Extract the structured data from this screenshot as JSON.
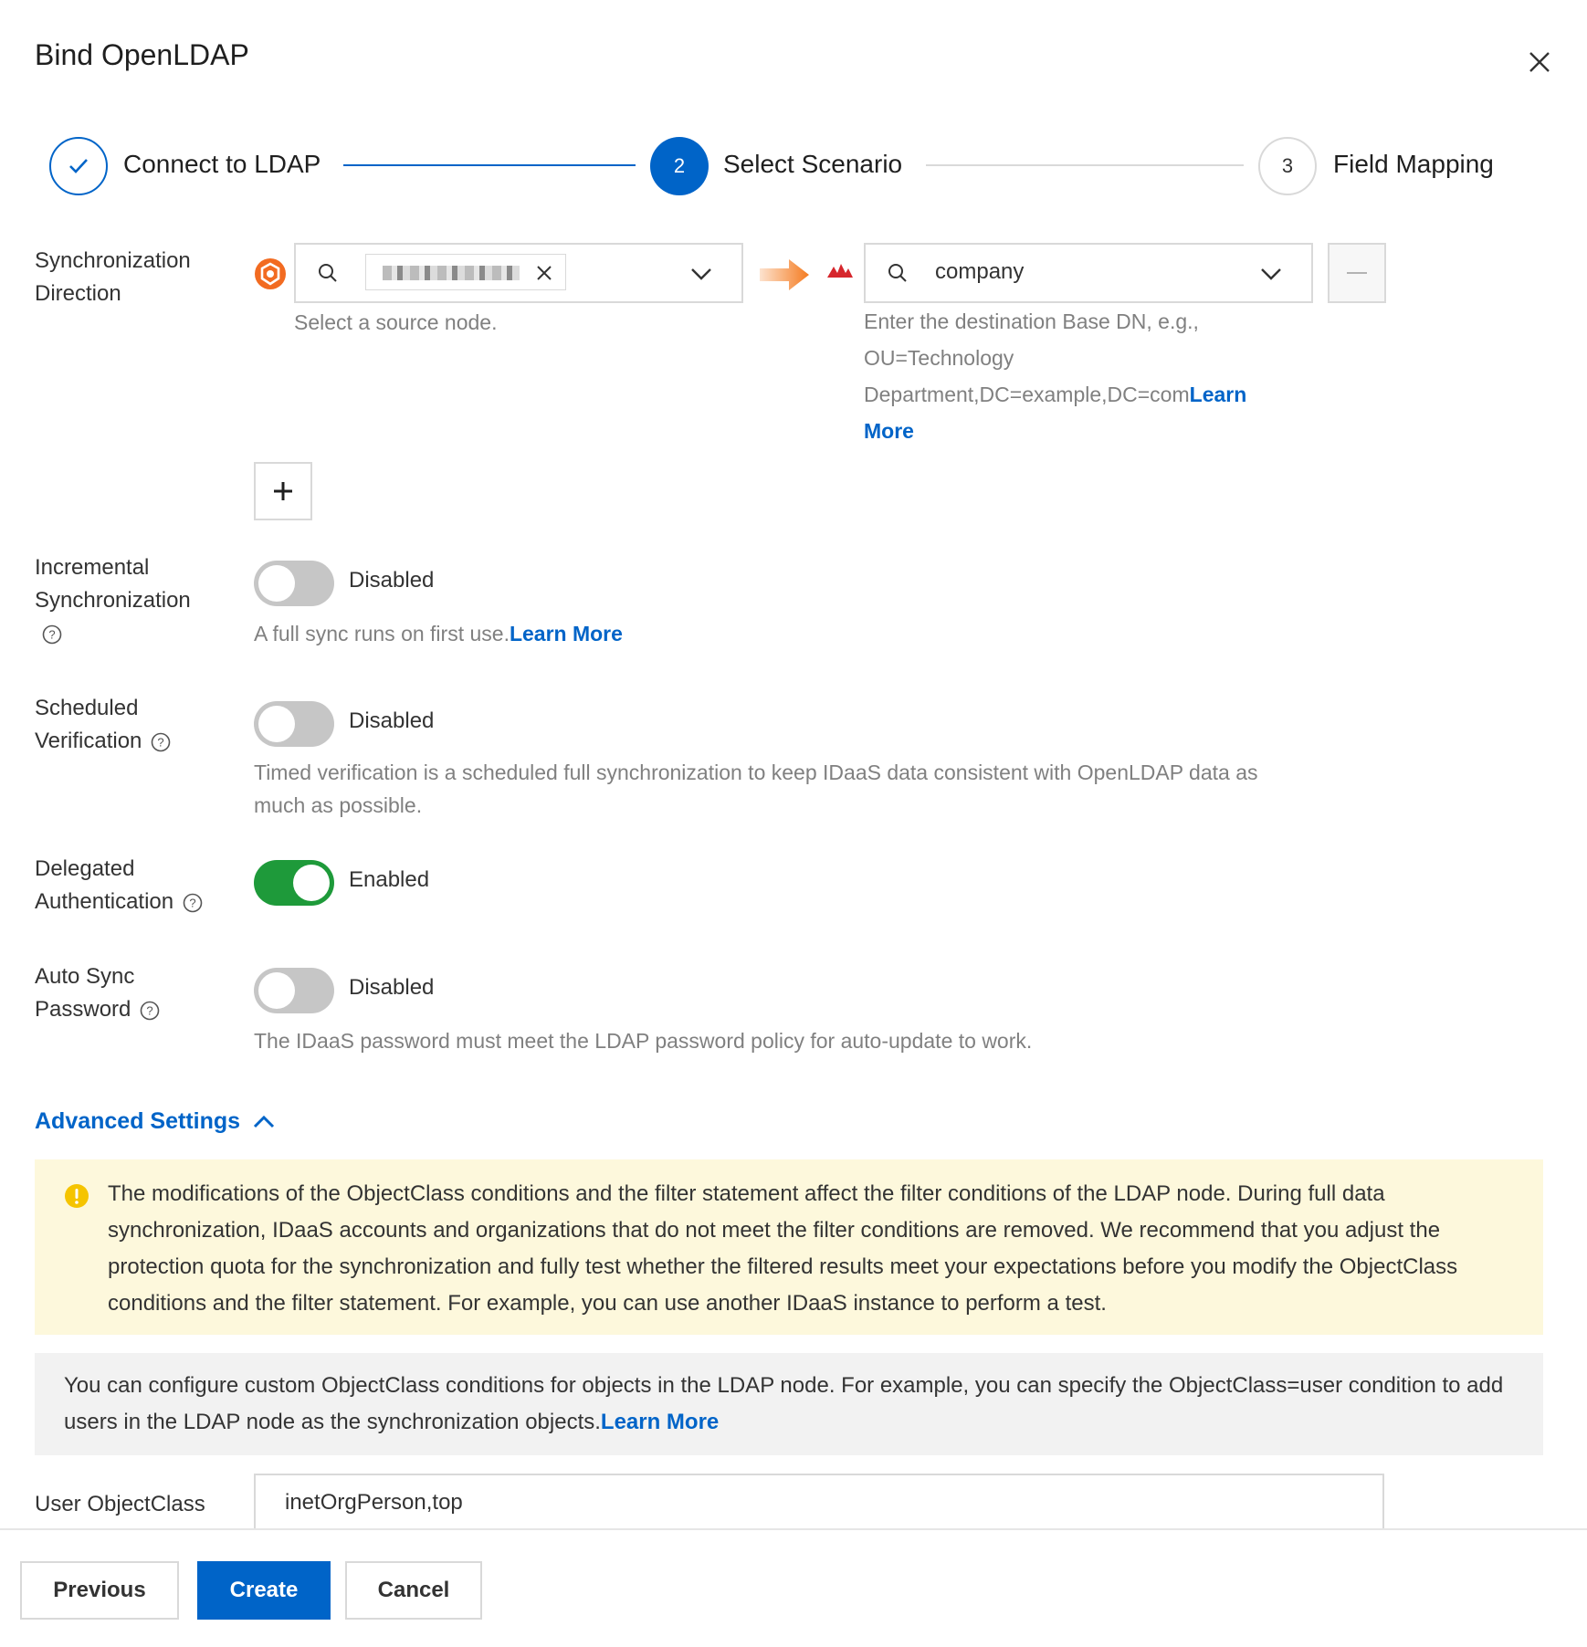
{
  "dialog": {
    "title": "Bind OpenLDAP"
  },
  "steps": [
    {
      "label": "Connect to LDAP",
      "status": "done"
    },
    {
      "number": "2",
      "label": "Select Scenario",
      "status": "active"
    },
    {
      "number": "3",
      "label": "Field Mapping",
      "status": "pending"
    }
  ],
  "sync_direction": {
    "label_line1": "Synchronization",
    "label_line2": "Direction",
    "source": {
      "icon": "idaas-logo-icon",
      "selected_tag": "redacted",
      "hint": "Select a source node."
    },
    "destination": {
      "icon": "openldap-logo-icon",
      "value": "company",
      "hint_line1": "Enter the destination Base DN, e.g.,",
      "hint_line2": "OU=Technology",
      "hint_line3": "Department,DC=example,DC=com",
      "link_part1": "Learn",
      "link_part2": "More"
    },
    "add_label": "+"
  },
  "incremental_sync": {
    "label_line1": "Incremental",
    "label_line2": "Synchronization",
    "state": "Disabled",
    "hint": "A full sync runs on first use.",
    "link": "Learn More"
  },
  "scheduled_verification": {
    "label_line1": "Scheduled",
    "label_line2": "Verification",
    "state": "Disabled",
    "hint_line1": "Timed verification is a scheduled full synchronization to keep IDaaS data consistent with OpenLDAP data as",
    "hint_line2": "much as possible."
  },
  "delegated_auth": {
    "label_line1": "Delegated",
    "label_line2": "Authentication",
    "state": "Enabled"
  },
  "auto_sync_password": {
    "label_line1": "Auto Sync",
    "label_line2": "Password",
    "state": "Disabled",
    "hint": "The IDaaS password must meet the LDAP password policy for auto-update to work."
  },
  "advanced": {
    "label": "Advanced Settings",
    "warning": "The modifications of the ObjectClass conditions and the filter statement affect the filter conditions of the LDAP node. During full data synchronization, IDaaS accounts and organizations that do not meet the filter conditions are removed. We recommend that you adjust the protection quota for the synchronization and fully test whether the filtered results meet your expectations before you modify the ObjectClass conditions and the filter statement. For example, you can use another IDaaS instance to perform a test.",
    "info": "You can configure custom ObjectClass conditions for objects in the LDAP node. For example, you can specify the ObjectClass=user condition to add users in the LDAP node as the synchronization objects.",
    "info_link": "Learn More",
    "user_objectclass_label": "User ObjectClass",
    "user_objectclass_value": "inetOrgPerson,top"
  },
  "footer": {
    "previous": "Previous",
    "create": "Create",
    "cancel": "Cancel"
  },
  "colors": {
    "primary": "#0064c8",
    "toggle_on": "#1e9a3a",
    "toggle_off": "#c6c6c6",
    "warning_bg": "#fdf8dc",
    "info_bg": "#f2f2f2"
  }
}
